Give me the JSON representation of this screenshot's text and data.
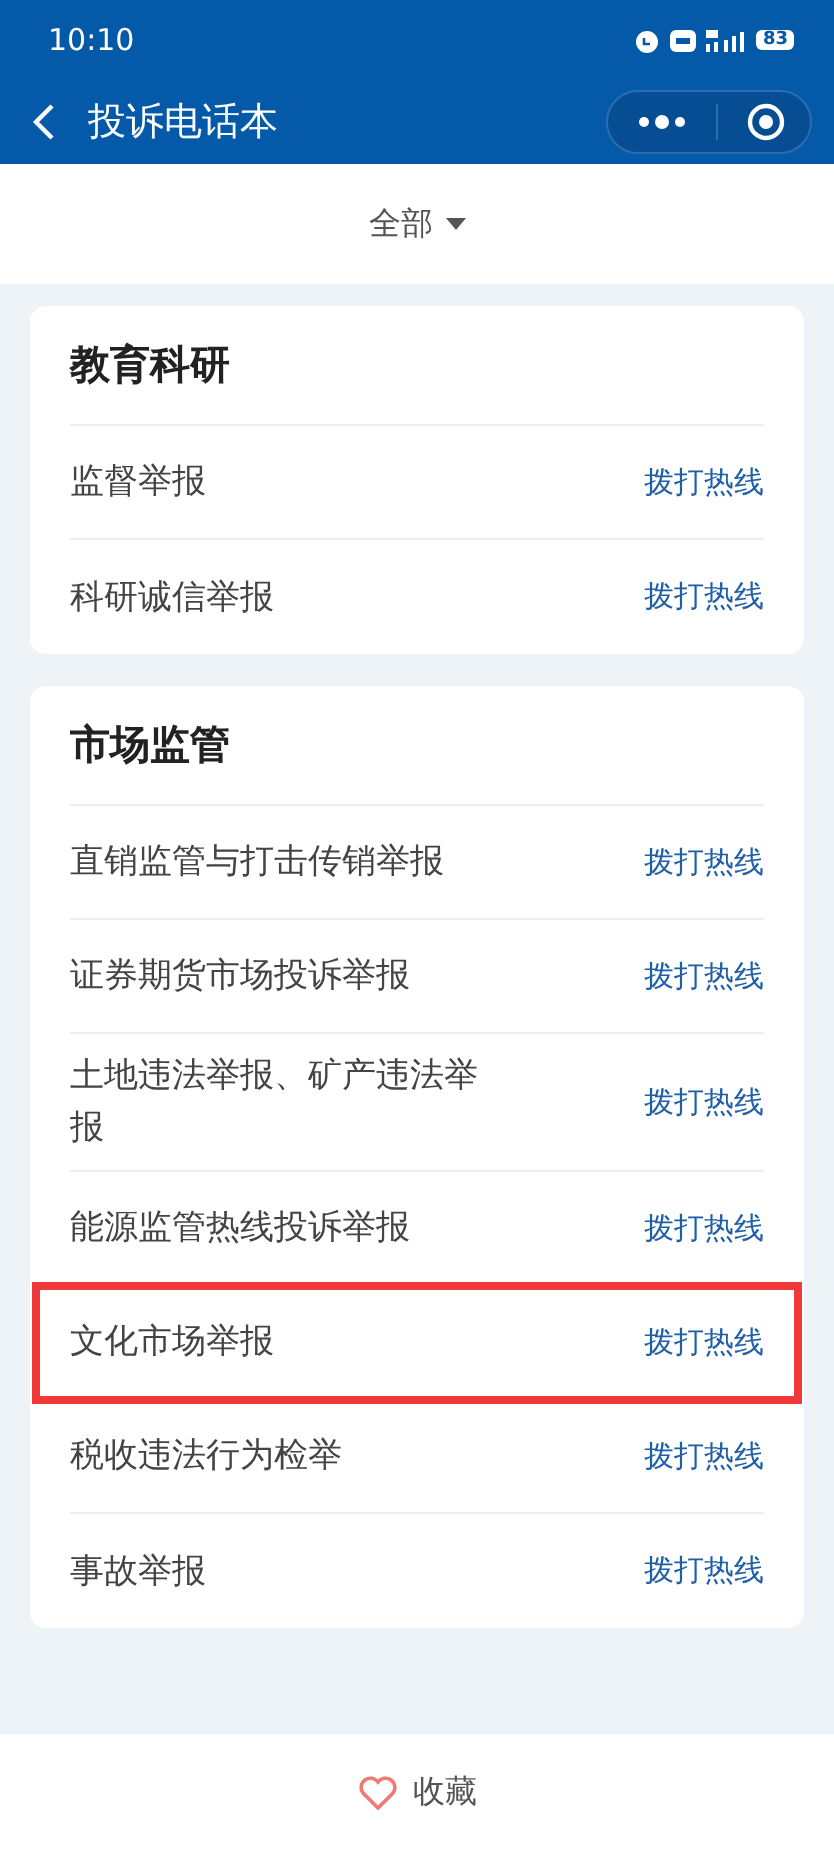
{
  "status_bar": {
    "time": "10:10",
    "battery": "83"
  },
  "header": {
    "title": "投诉电话本"
  },
  "filter": {
    "label": "全部"
  },
  "groups": [
    {
      "title": "教育科研",
      "items": [
        {
          "name": "监督举报",
          "action": "拨打热线",
          "highlighted": false
        },
        {
          "name": "科研诚信举报",
          "action": "拨打热线",
          "highlighted": false
        }
      ]
    },
    {
      "title": "市场监管",
      "items": [
        {
          "name": "直销监管与打击传销举报",
          "action": "拨打热线",
          "highlighted": false
        },
        {
          "name": "证券期货市场投诉举报",
          "action": "拨打热线",
          "highlighted": false
        },
        {
          "name": "土地违法举报、矿产违法举报",
          "action": "拨打热线",
          "highlighted": false
        },
        {
          "name": "能源监管热线投诉举报",
          "action": "拨打热线",
          "highlighted": false
        },
        {
          "name": "文化市场举报",
          "action": "拨打热线",
          "highlighted": true
        },
        {
          "name": "税收违法行为检举",
          "action": "拨打热线",
          "highlighted": false
        },
        {
          "name": "事故举报",
          "action": "拨打热线",
          "highlighted": false
        }
      ]
    }
  ],
  "bottom_bar": {
    "favorite": "收藏"
  }
}
